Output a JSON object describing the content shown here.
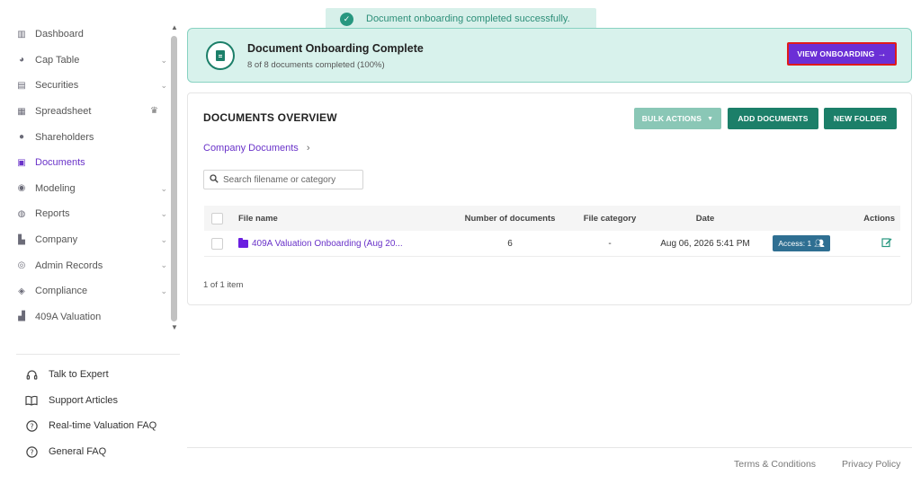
{
  "sidebar": {
    "items": [
      {
        "label": "Dashboard",
        "icon": "dashboard-icon",
        "glyph": "▥",
        "chevron": false
      },
      {
        "label": "Cap Table",
        "icon": "pie-chart-icon",
        "glyph": "◕",
        "chevron": true
      },
      {
        "label": "Securities",
        "icon": "clipboard-icon",
        "glyph": "▤",
        "chevron": true
      },
      {
        "label": "Spreadsheet",
        "icon": "table-icon",
        "glyph": "▦",
        "crown": true
      },
      {
        "label": "Shareholders",
        "icon": "person-icon",
        "glyph": "●",
        "chevron": false
      },
      {
        "label": "Documents",
        "icon": "folder-icon",
        "glyph": "▣",
        "chevron": false,
        "active": true
      },
      {
        "label": "Modeling",
        "icon": "lightbulb-icon",
        "glyph": "◉",
        "chevron": true
      },
      {
        "label": "Reports",
        "icon": "reports-icon",
        "glyph": "◍",
        "chevron": true
      },
      {
        "label": "Company",
        "icon": "building-icon",
        "glyph": "▙",
        "chevron": true
      },
      {
        "label": "Admin Records",
        "icon": "admin-icon",
        "glyph": "◎",
        "chevron": true
      },
      {
        "label": "Compliance",
        "icon": "shield-icon",
        "glyph": "◈",
        "chevron": true
      },
      {
        "label": "409A Valuation",
        "icon": "valuation-chart-icon",
        "glyph": "▟",
        "chevron": false
      }
    ],
    "help": [
      {
        "label": "Talk to Expert",
        "icon": "headset-icon",
        "glyph": "♫"
      },
      {
        "label": "Support Articles",
        "icon": "book-icon",
        "glyph": "▯"
      },
      {
        "label": "Real-time Valuation FAQ",
        "icon": "question-icon",
        "glyph": "?"
      },
      {
        "label": "General FAQ",
        "icon": "question-icon",
        "glyph": "?"
      }
    ]
  },
  "toast": {
    "message": "Document onboarding completed successfully."
  },
  "banner": {
    "title": "Document Onboarding Complete",
    "subtitle": "8 of 8 documents completed (100%)",
    "button": "VIEW ONBOARDING"
  },
  "documents": {
    "title": "DOCUMENTS OVERVIEW",
    "bulk_actions": "BULK ACTIONS",
    "add_documents": "ADD DOCUMENTS",
    "new_folder": "NEW FOLDER",
    "breadcrumb": "Company Documents",
    "search_placeholder": "Search filename or category",
    "columns": {
      "file_name": "File name",
      "num_docs": "Number of documents",
      "category": "File category",
      "date": "Date",
      "actions": "Actions"
    },
    "rows": [
      {
        "file_name": "409A Valuation Onboarding (Aug 20...",
        "num_docs": "6",
        "category": "-",
        "date": "Aug 06, 2026 5:41 PM",
        "access": "Access: 1"
      }
    ],
    "pager": "1 of 1 item"
  },
  "footer": {
    "terms": "Terms & Conditions",
    "privacy": "Privacy Policy"
  },
  "colors": {
    "accent": "#6a33c9",
    "teal": "#1c7f69",
    "banner_bg": "#d8f2ec"
  }
}
